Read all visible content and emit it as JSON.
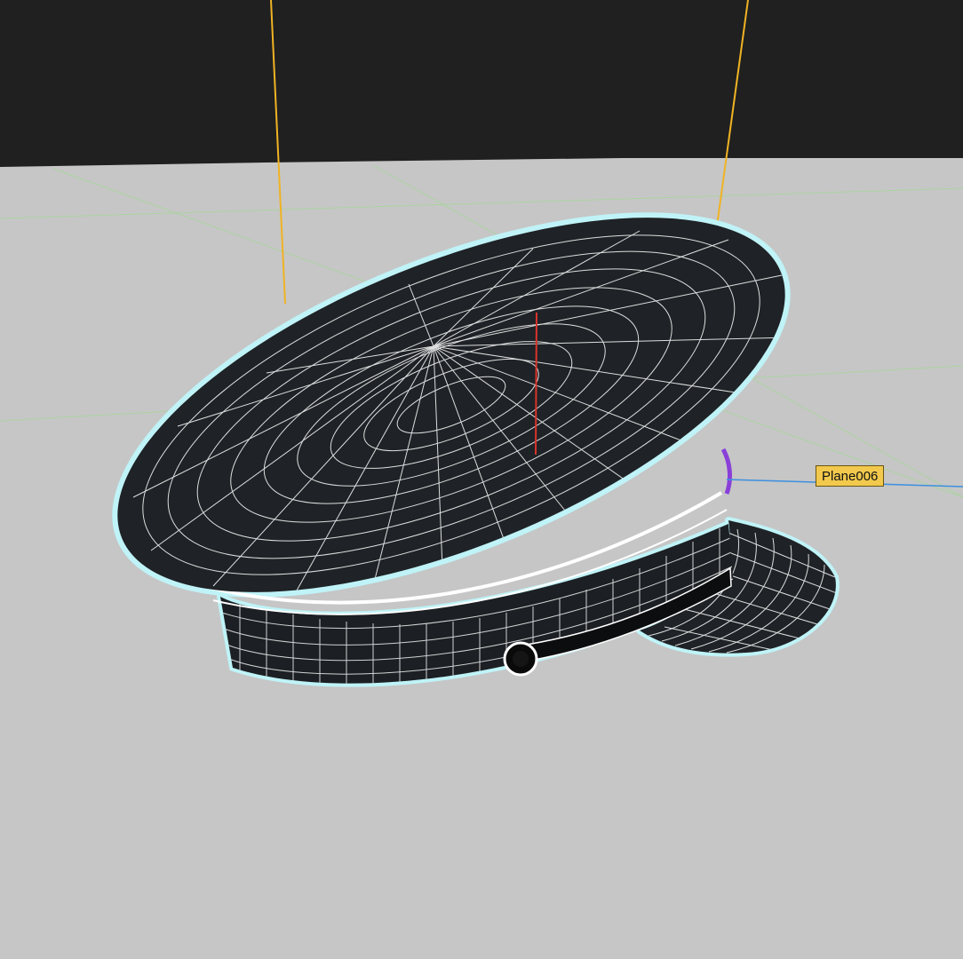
{
  "viewport": {
    "selected_object_label": "Plane006",
    "colors": {
      "background_upper": "#202020",
      "ground": "#c6c6c6",
      "mesh_fill": "#1f2226",
      "wireframe": "#ffffff",
      "selection_outline": "#bff3f7",
      "light_guide": "#f0b323",
      "pivot_axis": "#d9342b",
      "label_bg": "#f2c94c",
      "pointer_line": "#3b8fe0",
      "accent": "#8a3fd9"
    }
  }
}
